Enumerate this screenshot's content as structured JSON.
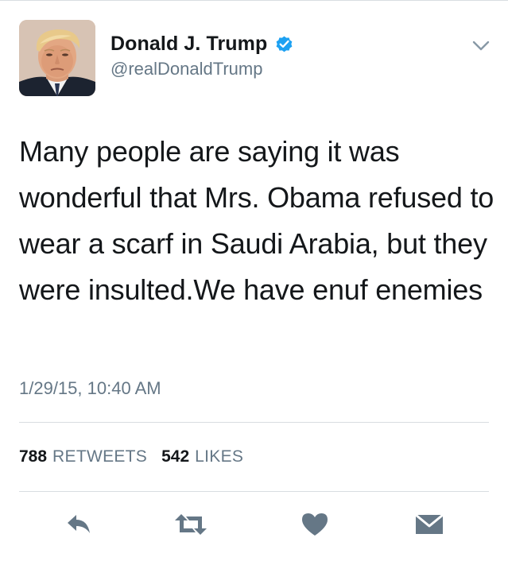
{
  "user": {
    "display_name": "Donald J. Trump",
    "handle": "@realDonaldTrump",
    "verified": true,
    "avatar_alt": "Donald J. Trump profile photo"
  },
  "tweet": {
    "text": "Many people are saying it was wonderful that Mrs. Obama refused to wear a scarf in Saudi Arabia, but they were insulted.We have enuf enemies",
    "timestamp": "1/29/15, 10:40 AM"
  },
  "stats": {
    "retweets_count": "788",
    "retweets_label": "RETWEETS",
    "likes_count": "542",
    "likes_label": "LIKES"
  },
  "actions": {
    "reply_icon": "reply-icon",
    "retweet_icon": "retweet-icon",
    "like_icon": "heart-icon",
    "dm_icon": "envelope-icon"
  },
  "colors": {
    "verified_badge": "#1da1f2",
    "secondary_text": "#657786",
    "action_icons": "#657786",
    "divider": "#d8dde1"
  }
}
